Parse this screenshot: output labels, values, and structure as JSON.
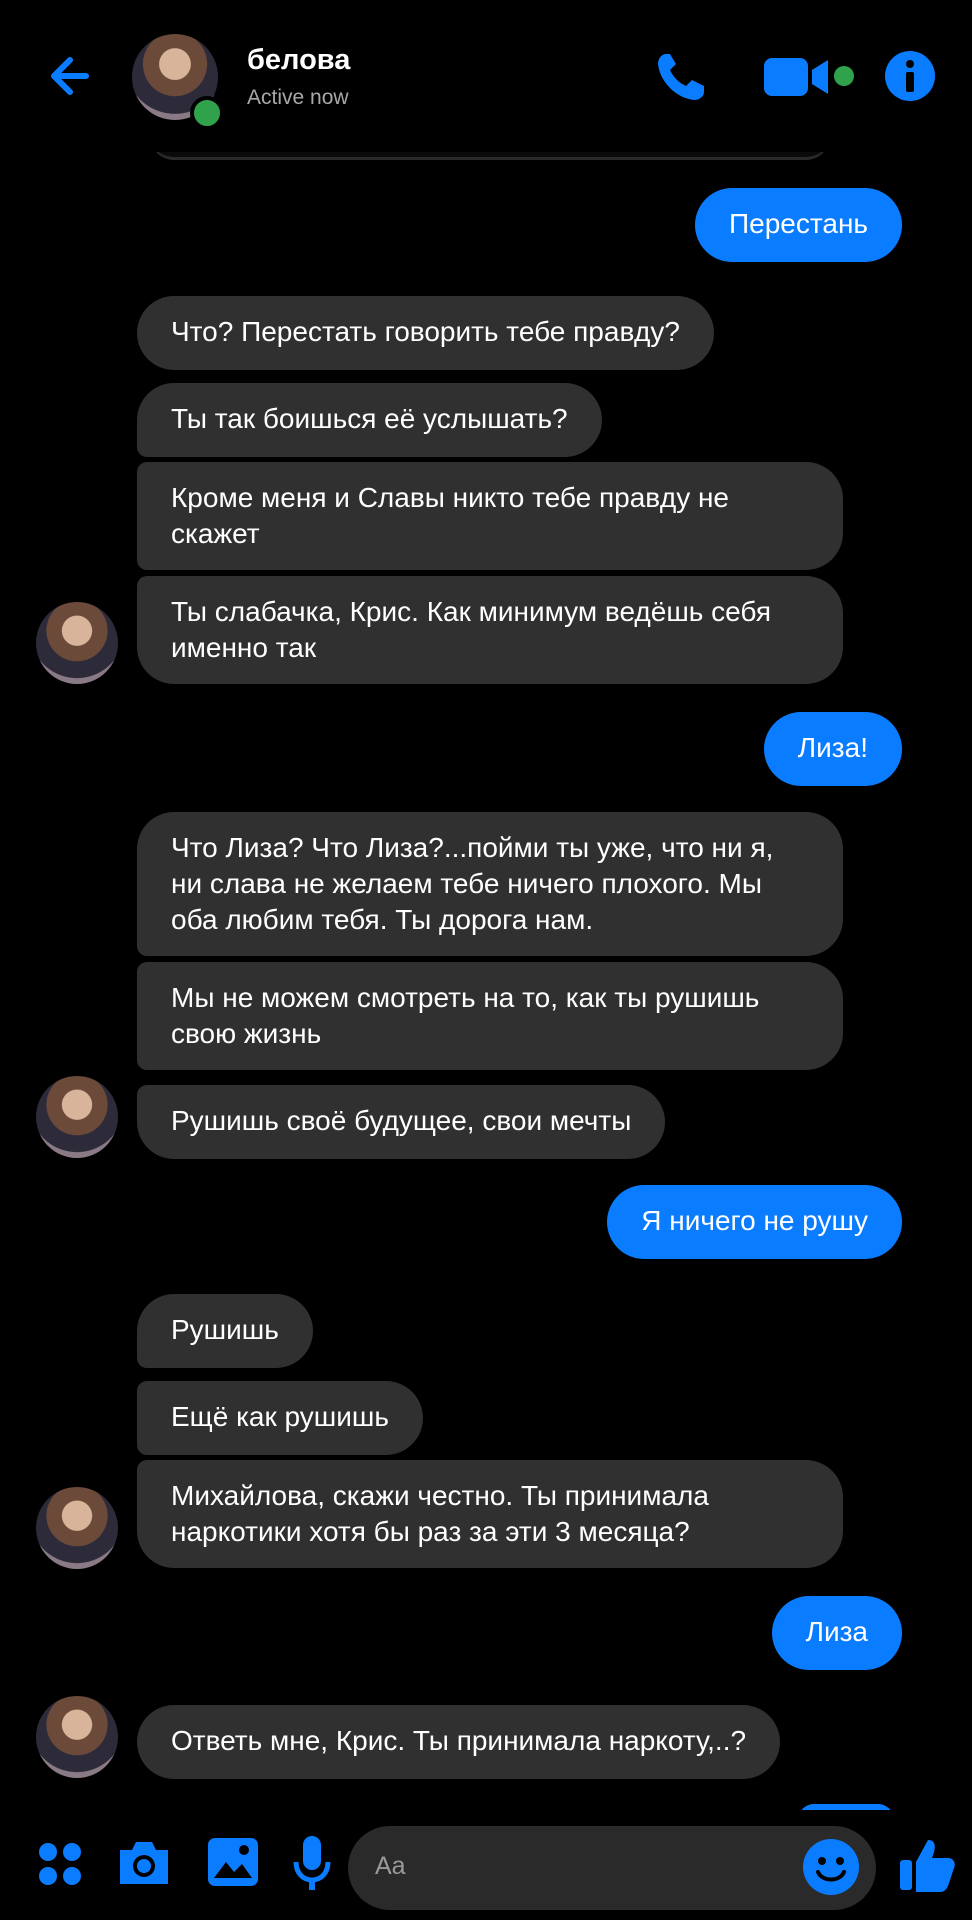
{
  "header": {
    "name": "белова",
    "status": "Active now"
  },
  "messages": [
    {
      "from": "them",
      "text": "Что? Перестать говорить тебе правду?"
    },
    {
      "from": "me",
      "text": "Перестань"
    },
    {
      "from": "them",
      "text": "Ты так боишься её услышать?"
    },
    {
      "from": "them",
      "text": "Кроме меня и Славы никто тебе правду не скажет"
    },
    {
      "from": "them",
      "text": "Ты слабачка, Крис. Как минимум ведёшь себя именно так"
    },
    {
      "from": "me",
      "text": "Лиза!"
    },
    {
      "from": "them",
      "text": "Что Лиза? Что Лиза?...пойми ты уже, что ни я, ни слава не желаем тебе ничего плохого. Мы оба любим тебя. Ты дорога нам."
    },
    {
      "from": "them",
      "text": "Мы не можем смотреть на то, как ты рушишь свою жизнь"
    },
    {
      "from": "them",
      "text": "Рушишь своё будущее,  свои мечты"
    },
    {
      "from": "me",
      "text": "Я ничего не рушу"
    },
    {
      "from": "them",
      "text": "Рушишь"
    },
    {
      "from": "them",
      "text": "Ещё как рушишь"
    },
    {
      "from": "them",
      "text": "Михайлова, скажи честно. Ты принимала наркотики хотя бы раз за эти 3 месяца?"
    },
    {
      "from": "me",
      "text": "Лиза"
    },
    {
      "from": "them",
      "text": "Ответь мне, Крис. Ты принимала наркоту,..?"
    }
  ],
  "composer": {
    "placeholder": "Aa"
  },
  "colors": {
    "accent": "#0a7cff",
    "incoming_bubble": "#303030",
    "online": "#31a24c"
  }
}
